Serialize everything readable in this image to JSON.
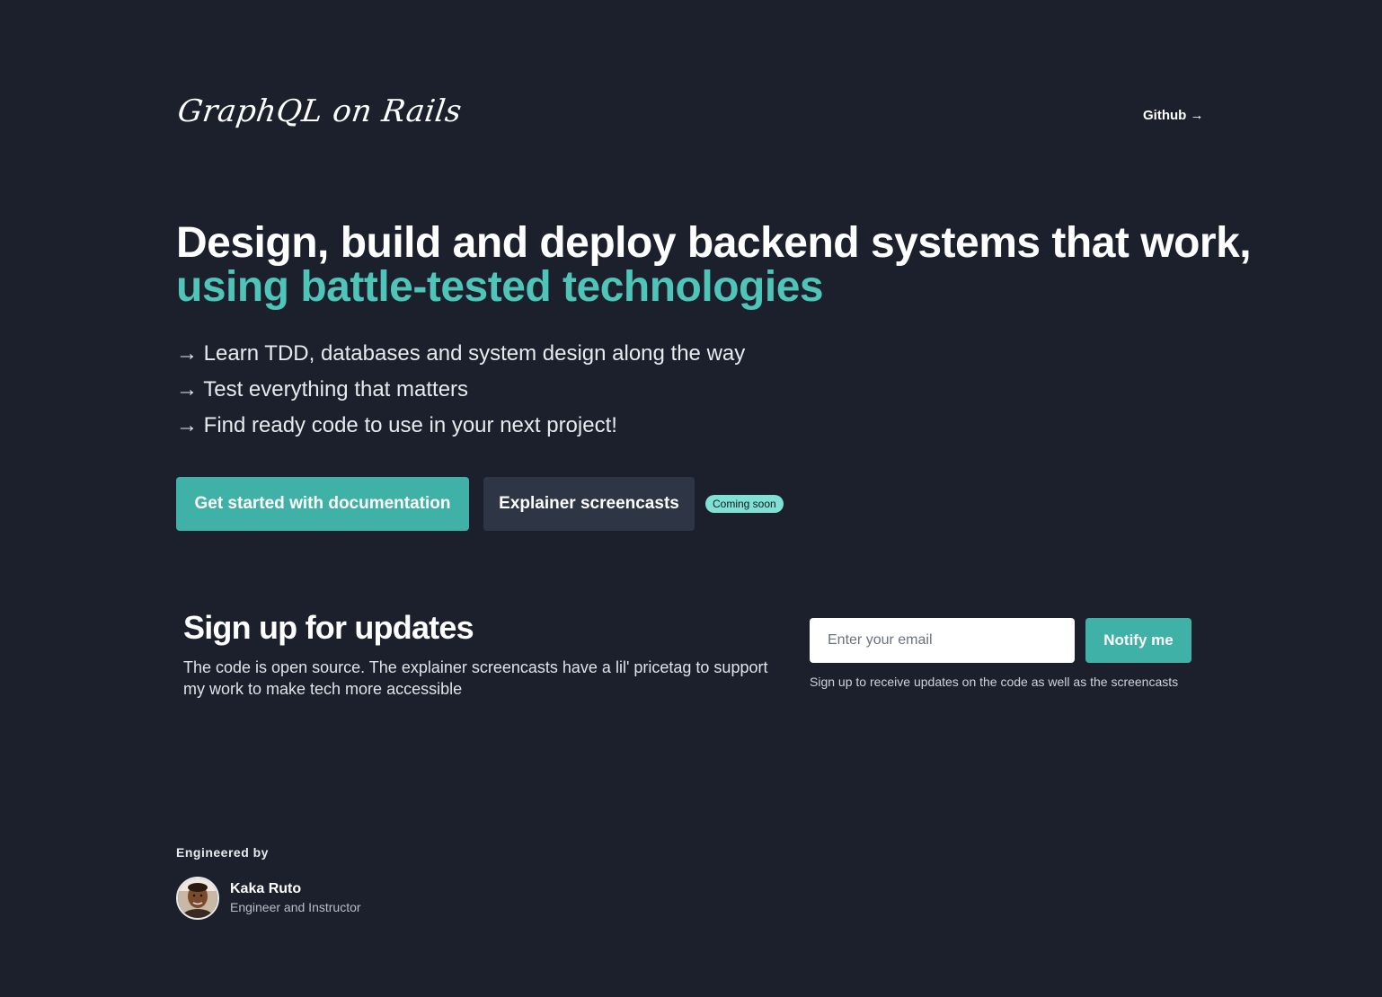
{
  "header": {
    "logo": "GraphQL on Rails",
    "github_link": "Github →"
  },
  "hero": {
    "title_line1": "Design, build and deploy backend systems that work,",
    "title_line2": "using battle-tested technologies",
    "bullets": [
      "→ Learn TDD, databases and system design along the way",
      "→ Test everything that matters",
      "→ Find ready code to use in your next project!"
    ],
    "primary_button": "Get started with documentation",
    "secondary_button": "Explainer screencasts",
    "badge": "Coming soon"
  },
  "signup": {
    "title": "Sign up for updates",
    "description": "The code is open source. The explainer screencasts have a lil' pricetag to support my work to make tech more accessible",
    "email_placeholder": "Enter your email",
    "button": "Notify me",
    "hint": "Sign up to receive updates on the code as well as the screencasts"
  },
  "footer": {
    "label": "Engineered by",
    "author_name": "Kaka Ruto",
    "author_role": "Engineer and Instructor"
  },
  "colors": {
    "background": "#1b202c",
    "accent": "#40b1a6",
    "accent_text": "#4fc4b8",
    "badge": "#7fe0d4",
    "secondary_button": "#2e3646"
  }
}
